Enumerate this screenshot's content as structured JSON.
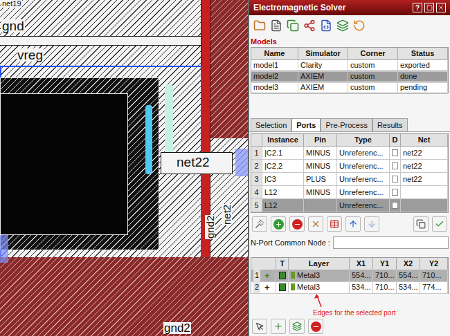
{
  "window": {
    "title": "Electromagnetic Solver",
    "help": "?"
  },
  "models": {
    "label": "Models",
    "columns": [
      "Name",
      "Simulator",
      "Corner",
      "Status"
    ],
    "rows": [
      {
        "name": "model1",
        "simulator": "Clarity",
        "corner": "custom",
        "status": "exported",
        "selected": false
      },
      {
        "name": "model2",
        "simulator": "AXIEM",
        "corner": "custom",
        "status": "done",
        "selected": true
      },
      {
        "name": "model3",
        "simulator": "AXIEM",
        "corner": "custom",
        "status": "pending",
        "selected": false
      }
    ]
  },
  "tabs": [
    {
      "label": "Selection",
      "selected": false
    },
    {
      "label": "Ports",
      "selected": true
    },
    {
      "label": "Pre-Process",
      "selected": false
    },
    {
      "label": "Results",
      "selected": false
    }
  ],
  "ports": {
    "columns": [
      "Instance",
      "Pin",
      "Type",
      "D",
      "Net"
    ],
    "rows": [
      {
        "index": "1",
        "instance": "|C2.1",
        "pin": "MINUS",
        "type": "Unreferenc...",
        "d": false,
        "net": "net22",
        "selected": false
      },
      {
        "index": "2",
        "instance": "|C2.2",
        "pin": "MINUS",
        "type": "Unreferenc...",
        "d": false,
        "net": "net22",
        "selected": false
      },
      {
        "index": "3",
        "instance": "|C3",
        "pin": "PLUS",
        "type": "Unreferenc...",
        "d": false,
        "net": "net22",
        "selected": false
      },
      {
        "index": "4",
        "instance": "L12",
        "pin": "MINUS",
        "type": "Unreferenc...",
        "d": false,
        "net": "",
        "selected": false
      },
      {
        "index": "5",
        "instance": "L12",
        "pin": "",
        "type": "Unreferenc...",
        "d": false,
        "net": "",
        "selected": true
      }
    ]
  },
  "n_port": {
    "label": "N-Port Common Node :",
    "value": ""
  },
  "edges": {
    "columns": [
      "",
      "T",
      "Layer",
      "X1",
      "Y1",
      "X2",
      "Y2"
    ],
    "rows": [
      {
        "index": "1",
        "sign": "+",
        "color": "#2e8b2e",
        "layer": "Metal3",
        "x1": "554...",
        "y1": "710...",
        "x2": "554...",
        "y2": "710...",
        "selected": true
      },
      {
        "index": "2",
        "sign": "+",
        "color": "#111111",
        "layer": "Metal3",
        "x1": "534...",
        "y1": "710...",
        "x2": "534...",
        "y2": "774...",
        "selected": false
      }
    ]
  },
  "annotation": "Edges for the selected port",
  "canvas": {
    "labels": [
      {
        "text": "net19",
        "kind": "horizontal"
      },
      {
        "text": "gnd",
        "kind": "horizontal"
      },
      {
        "text": "vreg",
        "kind": "horizontal"
      },
      {
        "text": "net22",
        "kind": "horizontal"
      },
      {
        "text": "gnd2",
        "kind": "vertical"
      },
      {
        "text": "net2",
        "kind": "vertical"
      },
      {
        "text": "gnd2",
        "kind": "horizontal"
      }
    ]
  }
}
